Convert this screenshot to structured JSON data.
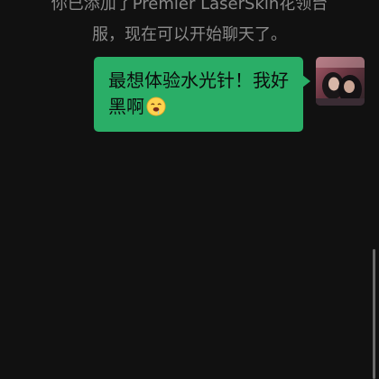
{
  "system_notice": {
    "line1": "你已添加了Premier LaserSkin花领台",
    "line2": "服，现在可以开始聊天了。"
  },
  "messages": [
    {
      "sender": "self",
      "text": "最想体验水光针！我好黑啊",
      "emoji": "drooling-face-icon"
    }
  ],
  "colors": {
    "background": "#111111",
    "bubble_self": "#2aae67",
    "notice_text": "#8a8a8a"
  }
}
